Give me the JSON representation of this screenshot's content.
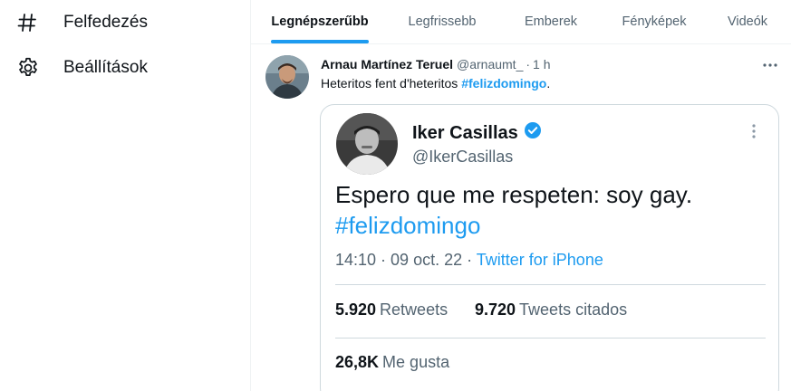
{
  "nav": {
    "items": [
      {
        "label": "Felfedezés",
        "icon": "hashtag-icon"
      },
      {
        "label": "Beállítások",
        "icon": "gear-icon"
      }
    ]
  },
  "tabs": [
    {
      "label": "Legnépszerűbb",
      "active": true
    },
    {
      "label": "Legfrissebb",
      "active": false
    },
    {
      "label": "Emberek",
      "active": false
    },
    {
      "label": "Fényképek",
      "active": false
    },
    {
      "label": "Videók",
      "active": false
    }
  ],
  "tweet": {
    "author_name": "Arnau Martínez Teruel",
    "author_handle": "@arnaumt_",
    "separator": "·",
    "time": "1 h",
    "text_before": "Heteritos fent d'heteritos ",
    "hashtag": "#felizdomingo",
    "text_after": ".",
    "media": {
      "name": "Iker Casillas",
      "handle": "@IkerCasillas",
      "text": "Espero que me respeten: soy gay.",
      "hashtag": "#felizdomingo",
      "meta_time": "14:10 · 09 oct. 22 · ",
      "meta_source": "Twitter for iPhone",
      "retweets_count": "5.920",
      "retweets_label": "Retweets",
      "quotes_count": "9.720",
      "quotes_label": "Tweets citados",
      "likes_count": "26,8K",
      "likes_label": "Me gusta"
    }
  },
  "colors": {
    "accent": "#1d9bf0",
    "text_primary": "#0f1419",
    "text_secondary": "#536471",
    "border": "#cfd9de"
  }
}
